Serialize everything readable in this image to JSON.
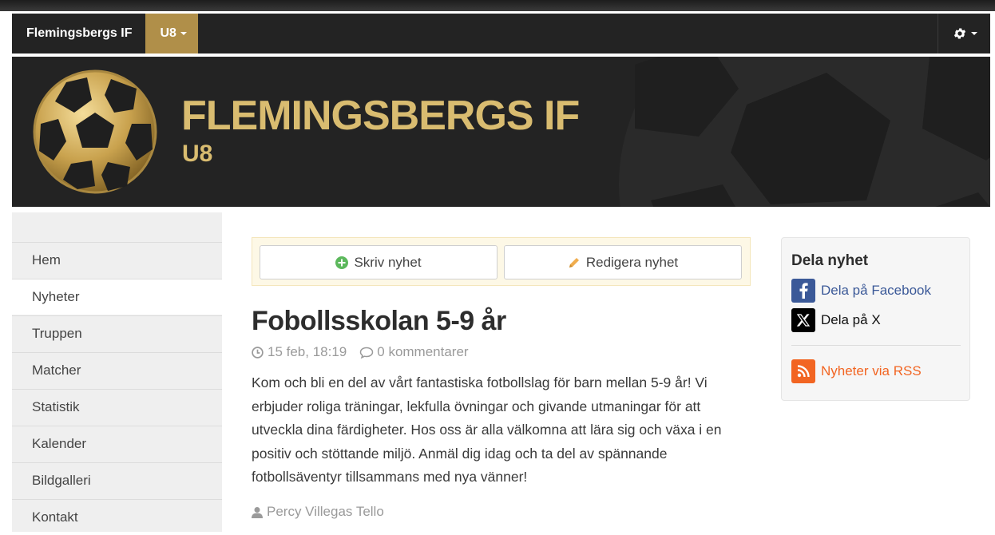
{
  "navbar": {
    "brand": "Flemingsbergs IF",
    "team": "U8"
  },
  "banner": {
    "title": "FLEMINGSBERGS IF",
    "subtitle": "U8"
  },
  "sidebar": {
    "items": [
      {
        "label": "Hem"
      },
      {
        "label": "Nyheter",
        "active": true
      },
      {
        "label": "Truppen"
      },
      {
        "label": "Matcher"
      },
      {
        "label": "Statistik"
      },
      {
        "label": "Kalender"
      },
      {
        "label": "Bildgalleri"
      },
      {
        "label": "Kontakt"
      }
    ]
  },
  "actions": {
    "write": "Skriv nyhet",
    "edit": "Redigera nyhet"
  },
  "post": {
    "title": "Fobollsskolan 5-9 år",
    "time": "15 feb, 18:19",
    "comments": "0 kommentarer",
    "body": "Kom och bli en del av vårt fantastiska fotbollslag för barn mellan 5-9 år! Vi erbjuder roliga träningar, lekfulla övningar och givande utmaningar för att utveckla dina färdigheter. Hos oss är alla välkomna att lära sig och växa i en positiv och stöttande miljö. Anmäl dig idag och ta del av spännande fotbollsäventyr tillsammans med nya vänner!",
    "author": "Percy Villegas Tello"
  },
  "share": {
    "title": "Dela nyhet",
    "facebook": "Dela på Facebook",
    "x": "Dela på X",
    "rss": "Nyheter via RSS"
  },
  "colors": {
    "gold": "#b08f49",
    "banner_text": "#d9bc70",
    "facebook": "#3b5998",
    "rss": "#f26522",
    "dark": "#232323"
  },
  "icons": [
    "gear-icon",
    "plus-circle-icon",
    "pencil-icon",
    "clock-icon",
    "comment-icon",
    "user-icon",
    "facebook-icon",
    "x-icon",
    "rss-icon",
    "football-logo"
  ]
}
